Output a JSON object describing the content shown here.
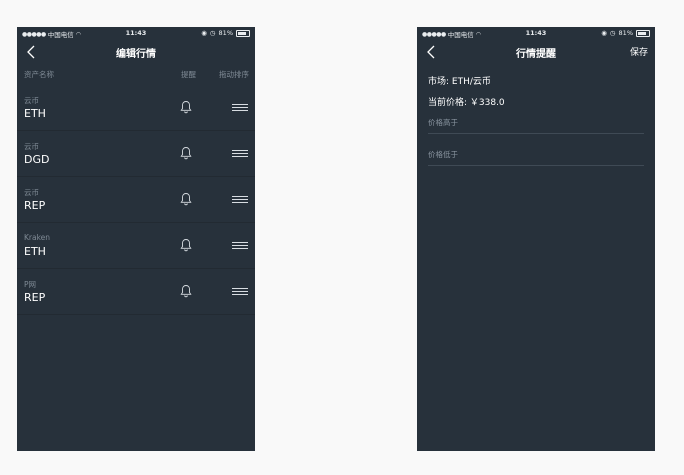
{
  "status_bar": {
    "carrier": "中国电信",
    "time": "11:43",
    "battery": "81%"
  },
  "screen_edit": {
    "title": "编辑行情",
    "columns": {
      "asset": "资产名称",
      "alert": "提醒",
      "sort": "拖动排序"
    },
    "rows": [
      {
        "market": "云币",
        "asset": "ETH"
      },
      {
        "market": "云币",
        "asset": "DGD"
      },
      {
        "market": "云币",
        "asset": "REP"
      },
      {
        "market": "Kraken",
        "asset": "ETH"
      },
      {
        "market": "P网",
        "asset": "REP"
      }
    ]
  },
  "screen_alert": {
    "title": "行情提醒",
    "save_label": "保存",
    "market_line": "市场: ETH/云币",
    "price_line": "当前价格: ￥338.0",
    "high_placeholder": "价格高于",
    "low_placeholder": "价格低于"
  },
  "colors": {
    "background": "#f9f9f9",
    "phone_bg": "#27313b",
    "muted_text": "#7f8a95"
  },
  "icons": [
    "back-chevron-icon",
    "bell-icon",
    "drag-handle-icon",
    "wifi-icon",
    "battery-icon"
  ]
}
